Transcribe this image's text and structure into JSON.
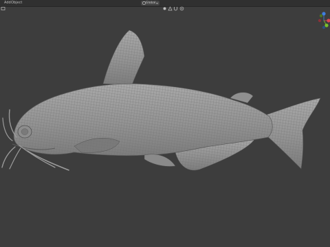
{
  "header": {
    "menu": [
      "Add",
      "Object"
    ],
    "transform_orientation": "Global",
    "tool_icons": [
      "editor-type-icon",
      "view-icon",
      "transform-pivot-icon",
      "snap-icon",
      "magnet-icon",
      "proportional-edit-icon"
    ]
  },
  "viewport": {
    "object": "catfish-mesh",
    "display": "wireframe-overlay",
    "colors": {
      "background": "#3d3d3d",
      "header": "#303030",
      "mesh": "#9a9a9a",
      "wire": "#6e6e6e"
    }
  },
  "gizmo": {
    "axes": [
      {
        "name": "x-axis",
        "color": "#e04552"
      },
      {
        "name": "y-axis",
        "color": "#7bbf2a"
      },
      {
        "name": "z-axis",
        "color": "#3f7fe0"
      }
    ]
  }
}
